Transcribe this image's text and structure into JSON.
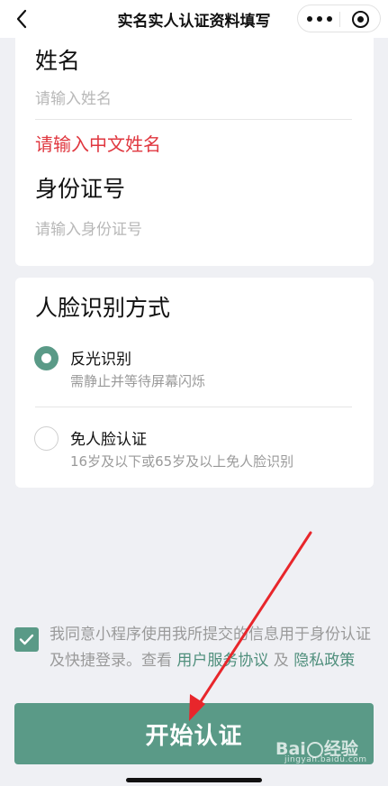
{
  "nav": {
    "title": "实名实人认证资料填写",
    "back_icon": "chevron-left-icon",
    "more_icon": "more-dots-icon",
    "close_icon": "target-close-icon"
  },
  "identity": {
    "name_label": "姓名",
    "name_placeholder": "请输入姓名",
    "name_error": "请输入中文姓名",
    "id_label": "身份证号",
    "id_placeholder": "请输入身份证号"
  },
  "face": {
    "title": "人脸识别方式",
    "options": [
      {
        "title": "反光识别",
        "subtitle": "需静止并等待屏幕闪烁",
        "checked": true
      },
      {
        "title": "免人脸认证",
        "subtitle": "16岁及以下或65岁及以上免人脸识别",
        "checked": false
      }
    ]
  },
  "agreement": {
    "checked": true,
    "text": "我同意小程序使用我所提交的信息用于身份认证及快捷登录。查看 ",
    "terms_link": "用户服务协议",
    "joiner": " 及 ",
    "privacy_link": "隐私政策"
  },
  "submit": {
    "label": "开始认证"
  },
  "colors": {
    "accent": "#5a9a87",
    "error": "#e0373f",
    "annotation_arrow": "#e8262b"
  },
  "watermark": {
    "brand_a": "Bai",
    "brand_b": "经验",
    "sub": "jingyan.baidu.com"
  }
}
